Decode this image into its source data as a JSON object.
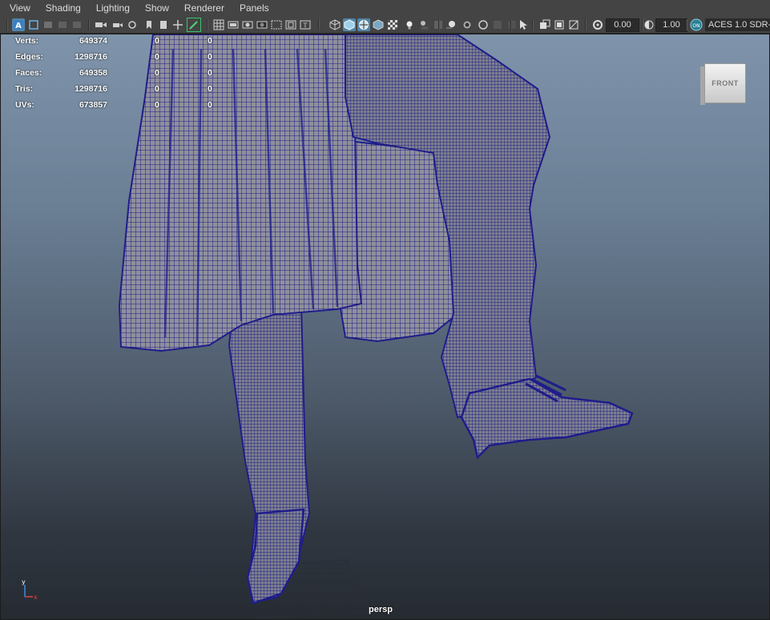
{
  "menubar": {
    "items": [
      "View",
      "Shading",
      "Lighting",
      "Show",
      "Renderer",
      "Panels"
    ]
  },
  "toolbar": {
    "exposure": "0.00",
    "gamma": "1.00",
    "color_management": "ACES 1.0 SDR-",
    "icons": [
      "select-camera-icon",
      "camera-attributes-icon",
      "bookmark-icon",
      "image-plane-icon",
      "2d-pan-zoom-icon",
      "grease-pencil-icon",
      "grid-icon",
      "film-gate-icon",
      "resolution-gate-icon",
      "gate-mask-icon",
      "field-chart-icon",
      "safe-action-icon",
      "safe-title-icon",
      "wireframe-icon",
      "smooth-shade-icon",
      "wireframe-on-shaded-icon",
      "xray-icon",
      "textured-icon",
      "use-lights-icon",
      "shadows-icon",
      "ambient-occlusion-icon",
      "motion-blur-icon",
      "anti-aliasing-icon",
      "depth-of-field-icon",
      "isolate-select-icon",
      "xray-joints-icon",
      "xray-active-icon",
      "exposure-icon",
      "gamma-icon",
      "color-management-icon"
    ]
  },
  "hud": {
    "rows": [
      {
        "label": "Verts:",
        "value": "649374",
        "c2": "0",
        "c3": "0"
      },
      {
        "label": "Edges:",
        "value": "1298716",
        "c2": "0",
        "c3": "0"
      },
      {
        "label": "Faces:",
        "value": "649358",
        "c2": "0",
        "c3": "0"
      },
      {
        "label": "Tris:",
        "value": "1298716",
        "c2": "0",
        "c3": "0"
      },
      {
        "label": "UVs:",
        "value": "673857",
        "c2": "0",
        "c3": "0"
      }
    ]
  },
  "viewcube": {
    "face": "FRONT"
  },
  "camera": "persp",
  "axis": {
    "y": "y",
    "x": "x"
  },
  "colors": {
    "wire": "#1f1d8a",
    "surface": "#8e8f9a",
    "accent": "#5285a6"
  }
}
